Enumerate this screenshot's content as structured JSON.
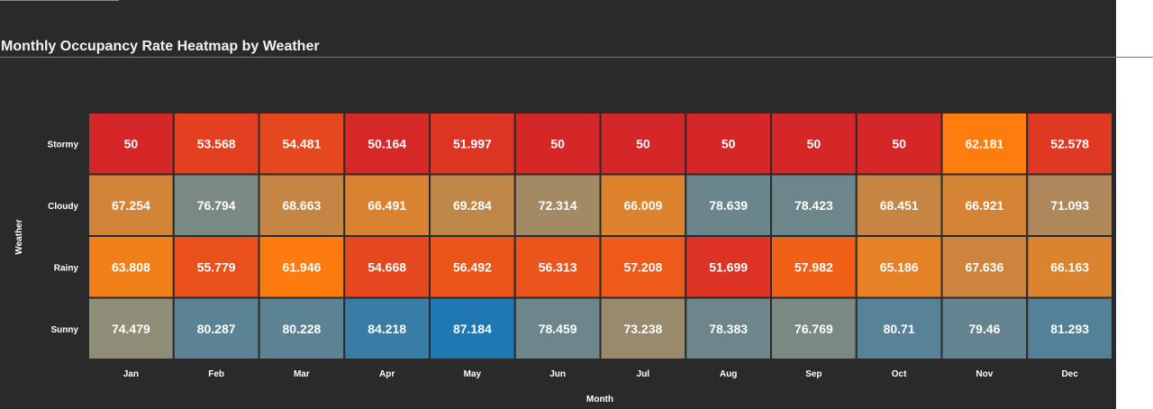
{
  "page": {
    "title": "Monthly Occupancy Rate Heatmap by Weather"
  },
  "colors": {
    "background": "#2a2a2a",
    "cell_border": "#2a2a2a",
    "text": "#ffffff",
    "scale": [
      "#d62728",
      "#ff7f0e",
      "#8c8c7a",
      "#1f77b4"
    ]
  },
  "chart_data": {
    "type": "heatmap",
    "title": "Monthly Occupancy Rate Heatmap by Weather",
    "xlabel": "Month",
    "ylabel": "Weather",
    "x_categories": [
      "Jan",
      "Feb",
      "Mar",
      "Apr",
      "May",
      "Jun",
      "Jul",
      "Aug",
      "Sep",
      "Oct",
      "Nov",
      "Dec"
    ],
    "y_categories": [
      "Stormy",
      "Cloudy",
      "Rainy",
      "Sunny"
    ],
    "values": [
      [
        50,
        53.568,
        54.481,
        50.164,
        51.997,
        50,
        50,
        50,
        50,
        50,
        62.181,
        52.578
      ],
      [
        67.254,
        76.794,
        68.663,
        66.491,
        69.284,
        72.314,
        66.009,
        78.639,
        78.423,
        68.451,
        66.921,
        71.093
      ],
      [
        63.808,
        55.779,
        61.946,
        54.668,
        56.492,
        56.313,
        57.208,
        51.699,
        57.982,
        65.186,
        67.636,
        66.163
      ],
      [
        74.479,
        80.287,
        80.228,
        84.218,
        87.184,
        78.459,
        73.238,
        78.383,
        76.769,
        80.71,
        79.46,
        81.293
      ]
    ],
    "color_range": [
      50,
      87.184
    ],
    "grid": false,
    "legend": "none"
  }
}
